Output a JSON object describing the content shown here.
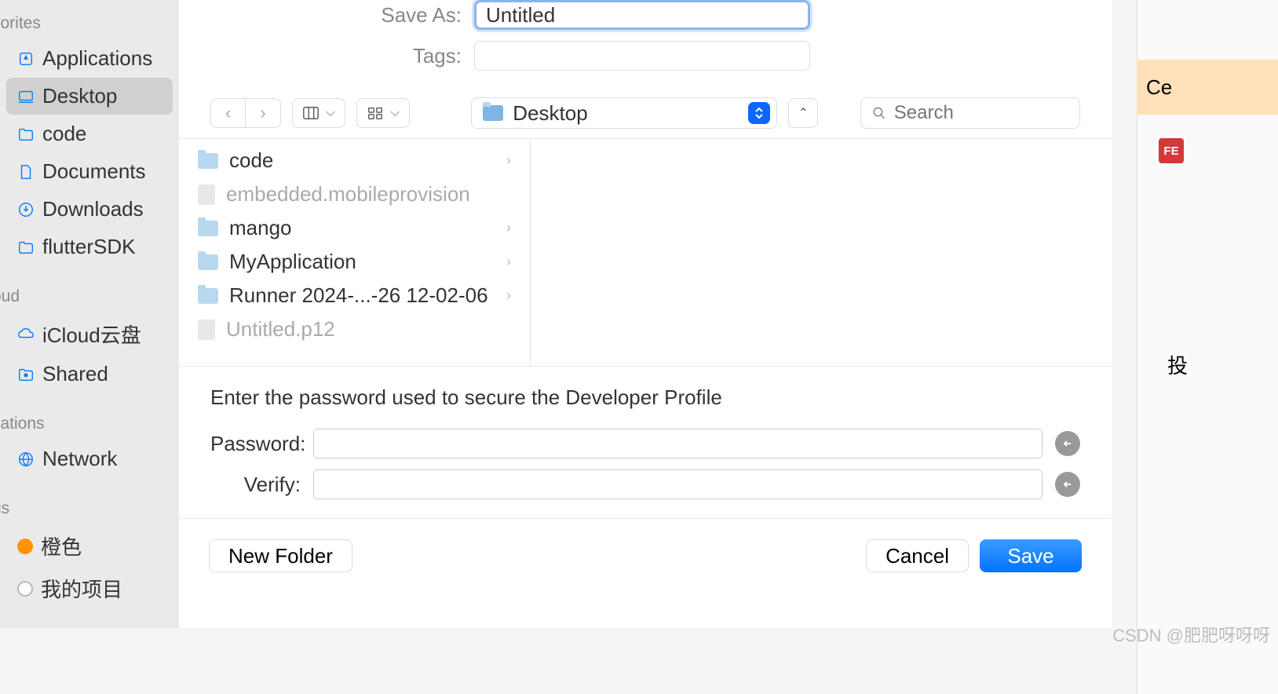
{
  "header": {
    "save_as_label": "Save As:",
    "save_as_value": "Untitled",
    "tags_label": "Tags:",
    "tags_value": ""
  },
  "toolbar": {
    "location": "Desktop",
    "search_placeholder": "Search"
  },
  "sidebar": {
    "favorites_title": "vorites",
    "favorites": [
      {
        "label": "Applications",
        "icon": "apps"
      },
      {
        "label": "Desktop",
        "icon": "desktop",
        "selected": true
      },
      {
        "label": "code",
        "icon": "folder"
      },
      {
        "label": "Documents",
        "icon": "doc"
      },
      {
        "label": "Downloads",
        "icon": "download"
      },
      {
        "label": "flutterSDK",
        "icon": "folder"
      }
    ],
    "icloud_title": "oud",
    "icloud": [
      {
        "label": "iCloud云盘",
        "icon": "cloud"
      },
      {
        "label": "Shared",
        "icon": "shared"
      }
    ],
    "locations_title": "cations",
    "locations": [
      {
        "label": "Network",
        "icon": "network"
      }
    ],
    "tags_title": "gs",
    "tags": [
      {
        "label": "橙色",
        "color": "#FF9500"
      },
      {
        "label": "我的项目",
        "color": "#ccc"
      }
    ]
  },
  "files": [
    {
      "name": "code",
      "type": "folder",
      "hasChildren": true
    },
    {
      "name": "embedded.mobileprovision",
      "type": "file",
      "disabled": true
    },
    {
      "name": "mango",
      "type": "folder",
      "hasChildren": true
    },
    {
      "name": "MyApplication",
      "type": "folder",
      "hasChildren": true
    },
    {
      "name": "Runner 2024-...-26 12-02-06",
      "type": "folder",
      "hasChildren": true
    },
    {
      "name": "Untitled.p12",
      "type": "file",
      "disabled": true
    }
  ],
  "password": {
    "prompt": "Enter the password used to secure the Developer Profile",
    "password_label": "Password:",
    "verify_label": "Verify:"
  },
  "footer": {
    "new_folder": "New Folder",
    "cancel": "Cancel",
    "save": "Save"
  },
  "right": {
    "tab": "Ce",
    "fe": "FE",
    "text": "投"
  },
  "watermark": "CSDN @肥肥呀呀呀"
}
